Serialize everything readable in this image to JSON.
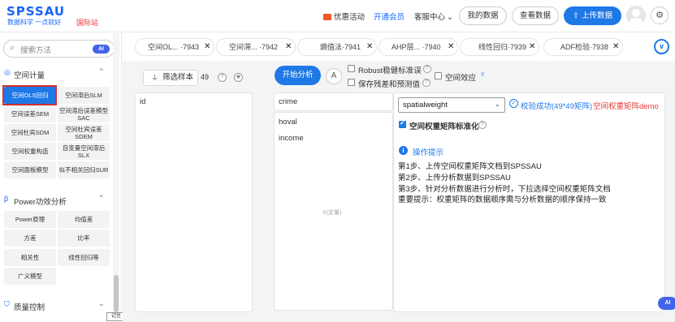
{
  "header": {
    "logo": "SPSSAU",
    "logo_sub": "数据科学 一点就好",
    "intl": "国际站",
    "promo": "优惠活动",
    "vip": "开通会员",
    "service": "客服中心",
    "service_chevron": "⌄",
    "my_data": "我的数据",
    "view_data": "查看数据",
    "upload": "上传数据",
    "upload_icon": "⇧",
    "gear_icon": "⚙"
  },
  "sidebar": {
    "search_placeholder": "搜索方法",
    "search_icon": "⌕",
    "ai_badge": "AI",
    "sections": [
      {
        "label": "空间计量",
        "icon": "◎",
        "chevron": "⌃"
      },
      {
        "label": "Power功效分析",
        "icon": "β",
        "chevron": "⌃"
      },
      {
        "label": "质量控制",
        "icon": "⛉",
        "chevron": "⌄"
      }
    ],
    "spatial_items": [
      "空间OLS回归",
      "空间滞后SLM",
      "空间误差SEM",
      "空间滞后误差模型SAC",
      "空间杜宾SDM",
      "空间杜宾误差SDEM",
      "空间权重构造",
      "自变量空间滞后SLX",
      "空间面板模型",
      "似不相关回归SUR"
    ],
    "power_items": [
      "Power原理",
      "均值差",
      "方差",
      "比率",
      "相关性",
      "线性回归等",
      "广义模型"
    ],
    "hint_tag": "记住"
  },
  "tabs": [
    {
      "label": "空间OL...  ·7943",
      "close": "✕"
    },
    {
      "label": "空间滞...  ·7942",
      "close": "✕"
    },
    {
      "label": "熵值法·7941",
      "close": "✕"
    },
    {
      "label": "AHP层...  ·7940",
      "close": "✕"
    },
    {
      "label": "线性回归·7939",
      "close": "✕"
    },
    {
      "label": "ADF检验·7938",
      "close": "✕"
    }
  ],
  "tabs_more_icon": "∨",
  "main": {
    "filter_label": "筛选样本",
    "filter_icon": "⏚",
    "var_count": "49",
    "help_icon": "?",
    "target_icon": "◉",
    "left_vars": [
      "id"
    ],
    "y_vars": [
      "crime"
    ],
    "x_vars": [
      "hoval",
      "income"
    ],
    "x_hint": "X(定量)",
    "swap_icon": "⇄",
    "start_label": "开始分析",
    "font_icon": "A",
    "options": {
      "robust": "Robust稳健标准误",
      "save_resid": "保存残差和预测值",
      "spatial_effect": "空间效应"
    },
    "bulb_icon": "♀",
    "weight_select": "spatialweight",
    "select_caret": "⌄",
    "check_icon": "✓",
    "verify_ok": "校验成功(49*49矩阵)",
    "demo_link": "空间权重矩阵demo",
    "normalize_label": "空间权重矩阵标准化",
    "info_icon": "i",
    "info_title": "操作提示",
    "steps": [
      "第1步、上传空间权重矩阵文档到SPSSAU",
      "第2步、上传分析数据到SPSSAU",
      "第3步、针对分析数据进行分析时，下拉选择空间权重矩阵文档",
      "重要提示：权重矩阵的数据顺序需与分析数据的顺序保持一致"
    ]
  },
  "ai_float": "AI",
  "colors": {
    "primary": "#1e78e6",
    "brand": "#1664ff",
    "alert": "#e53935",
    "ai": "#4363e8"
  }
}
